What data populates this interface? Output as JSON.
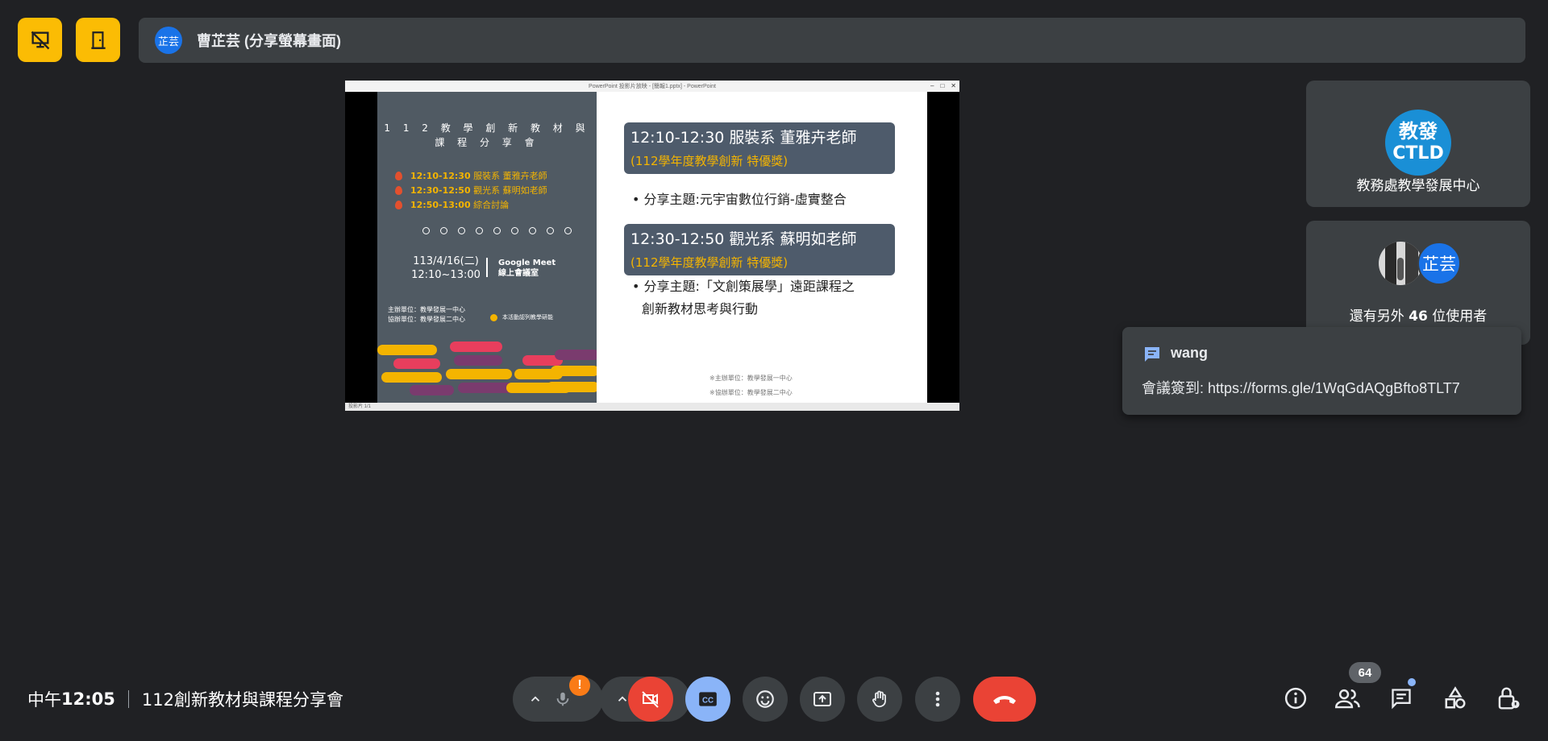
{
  "top_bar": {
    "presenter_avatar": "芷芸",
    "presenter_label": "曹芷芸 (分享螢幕畫面)"
  },
  "shared_screen": {
    "window_title": "PowerPoint 投影片放映 - [簡報1.pptx] - PowerPoint",
    "status_text": "投影片 1/1",
    "left_panel": {
      "title_line1": "1 1 2 教 學 創 新 教 材 與",
      "title_line2": "課 程 分 享 會",
      "schedule": [
        {
          "time": "12:10-12:30",
          "text": "服裝系 董雅卉老師"
        },
        {
          "time": "12:30-12:50",
          "text": "觀光系 蘇明如老師"
        },
        {
          "time": "12:50-13:00",
          "text": "綜合討論"
        }
      ],
      "date_line1": "113/4/16(二)",
      "date_line2": "12:10~13:00",
      "venue_line1": "Google Meet",
      "venue_line2": "線上會議室",
      "organizer": "主辦單位：教學發展一中心",
      "co_organizer": "協辦單位：教學發展二中心",
      "note": "本活動認列教學研能"
    },
    "right_panel": {
      "session1_title": "12:10-12:30 服裝系 董雅卉老師",
      "session1_award": "(112學年度教學創新 特優獎)",
      "session1_topic": "• 分享主題:元宇宙數位行銷-虛實整合",
      "session2_title": "12:30-12:50 觀光系 蘇明如老師",
      "session2_award": "(112學年度教學創新 特優獎)",
      "session2_topic_line1": "• 分享主題:「文創策展學」遠距課程之",
      "session2_topic_line2": "創新教材思考與行動",
      "footer1": "※主辦單位：教學發展一中心",
      "footer2": "※協辦單位：教學發展二中心"
    }
  },
  "participants": {
    "tile1_logo_line1": "教發",
    "tile1_logo_line2": "CTLD",
    "tile1_name": "教務處教學發展中心",
    "tile2_avatar": "芷芸",
    "tile2_label_prefix": "還有另外 ",
    "tile2_count": "46",
    "tile2_label_suffix": " 位使用者"
  },
  "chat_toast": {
    "sender": "wang",
    "message": "會議簽到: https://forms.gle/1WqGdAQgBfto8TLT7"
  },
  "bottom_bar": {
    "time_prefix": "中午",
    "time": "12:05",
    "meeting_title": "112創新教材與課程分享會",
    "mic_alert": "!",
    "people_count": "64",
    "colors": {
      "end_call": "#ea4335",
      "camera_off": "#ea4335",
      "captions_on": "#8ab4f8",
      "alert": "#fa7b17",
      "accent": "#fbbc04"
    }
  }
}
